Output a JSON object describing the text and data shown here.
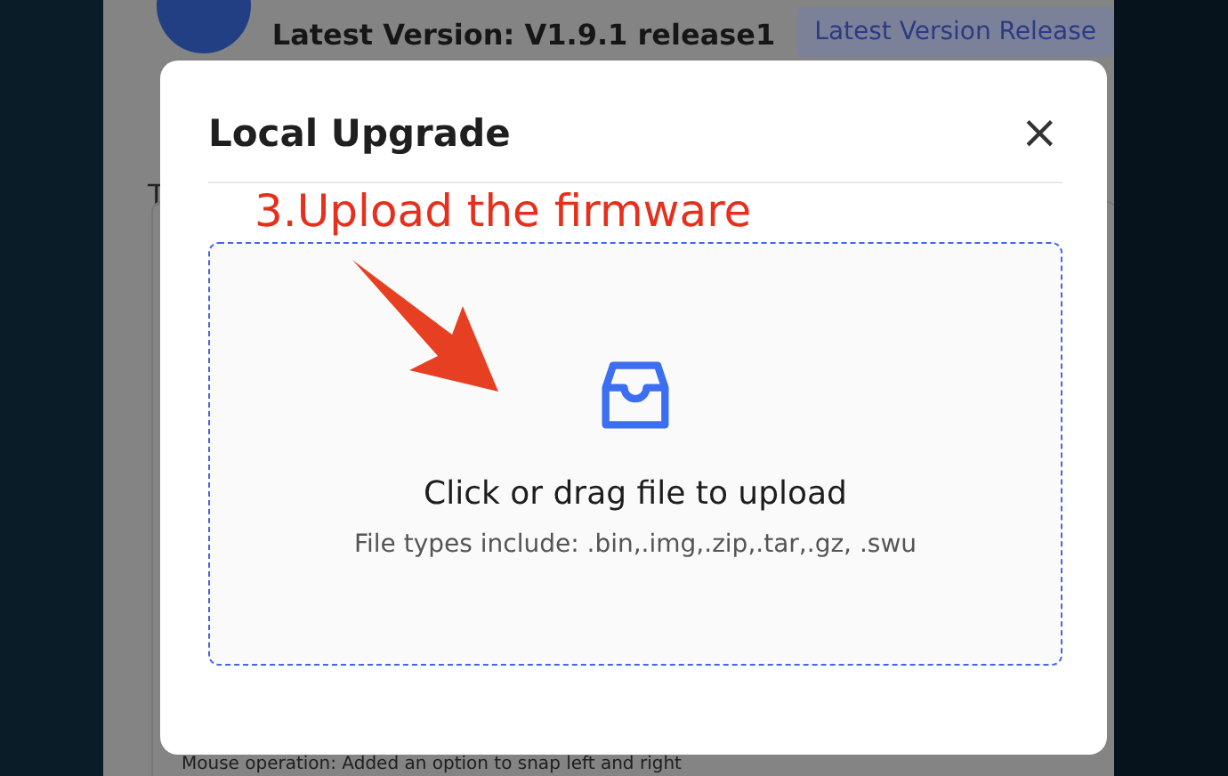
{
  "page": {
    "latest_version": "Latest Version: V1.9.1 release1",
    "release_button": "Latest Version Release",
    "cut_label": "T",
    "note": "Mouse operation: Added an option to snap left and right"
  },
  "dialog": {
    "title": "Local Upgrade",
    "close": "×",
    "upload": {
      "title": "Click or drag file to upload",
      "hint": "File types include: .bin,.img,.zip,.tar,.gz, .swu"
    }
  },
  "annotation": {
    "text": "3.Upload the firmware"
  }
}
